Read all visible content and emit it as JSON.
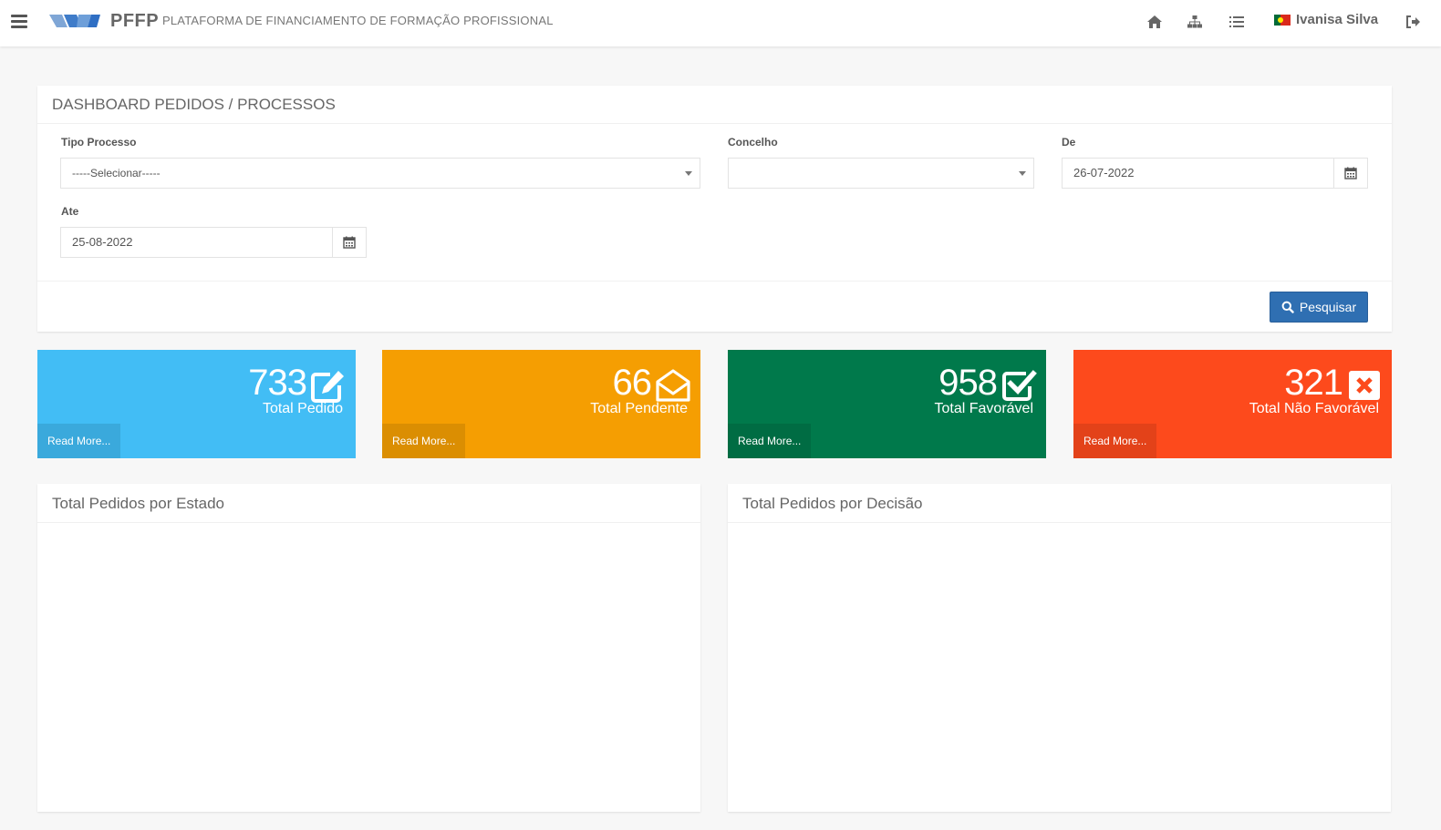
{
  "header": {
    "brand": "PFFP",
    "subtitle": "PLATAFORMA DE FINANCIAMENTO DE FORMAÇÃO PROFISSIONAL",
    "user_name": "Ivanisa Silva",
    "icons": [
      "menu-icon",
      "home-icon",
      "sitemap-icon",
      "list-icon",
      "portugal-flag-icon",
      "logout-icon"
    ]
  },
  "filters": {
    "title": "DASHBOARD PEDIDOS / PROCESSOS",
    "tipo_processo_label": "Tipo Processo",
    "tipo_processo_value": "-----Selecionar-----",
    "concelho_label": "Concelho",
    "concelho_value": "",
    "de_label": "De",
    "de_value": "26-07-2022",
    "ate_label": "Ate",
    "ate_value": "25-08-2022",
    "search_label": "Pesquisar"
  },
  "stats": [
    {
      "value": "733",
      "label": "Total Pedido",
      "more": "Read More...",
      "color": "#42bdf5",
      "more_bg": "#3aa9dc",
      "icon": "edit-icon"
    },
    {
      "value": "66",
      "label": "Total Pendente",
      "more": "Read More...",
      "color": "#f59e02",
      "more_bg": "#db8e02",
      "icon": "envelope-open-icon"
    },
    {
      "value": "958",
      "label": "Total Favorável",
      "more": "Read More...",
      "color": "#00794b",
      "more_bg": "#006c43",
      "icon": "check-square-icon"
    },
    {
      "value": "321",
      "label": "Total Não Favorável",
      "more": "Read More...",
      "color": "#fd4a1c",
      "more_bg": "#e34219",
      "icon": "times-square-icon"
    }
  ],
  "charts": {
    "estado_title": "Total Pedidos por Estado",
    "decisao_title": "Total Pedidos por Decisão"
  },
  "colors": {
    "primary_button": "#2f6fb2",
    "background": "#f7f7f7"
  }
}
